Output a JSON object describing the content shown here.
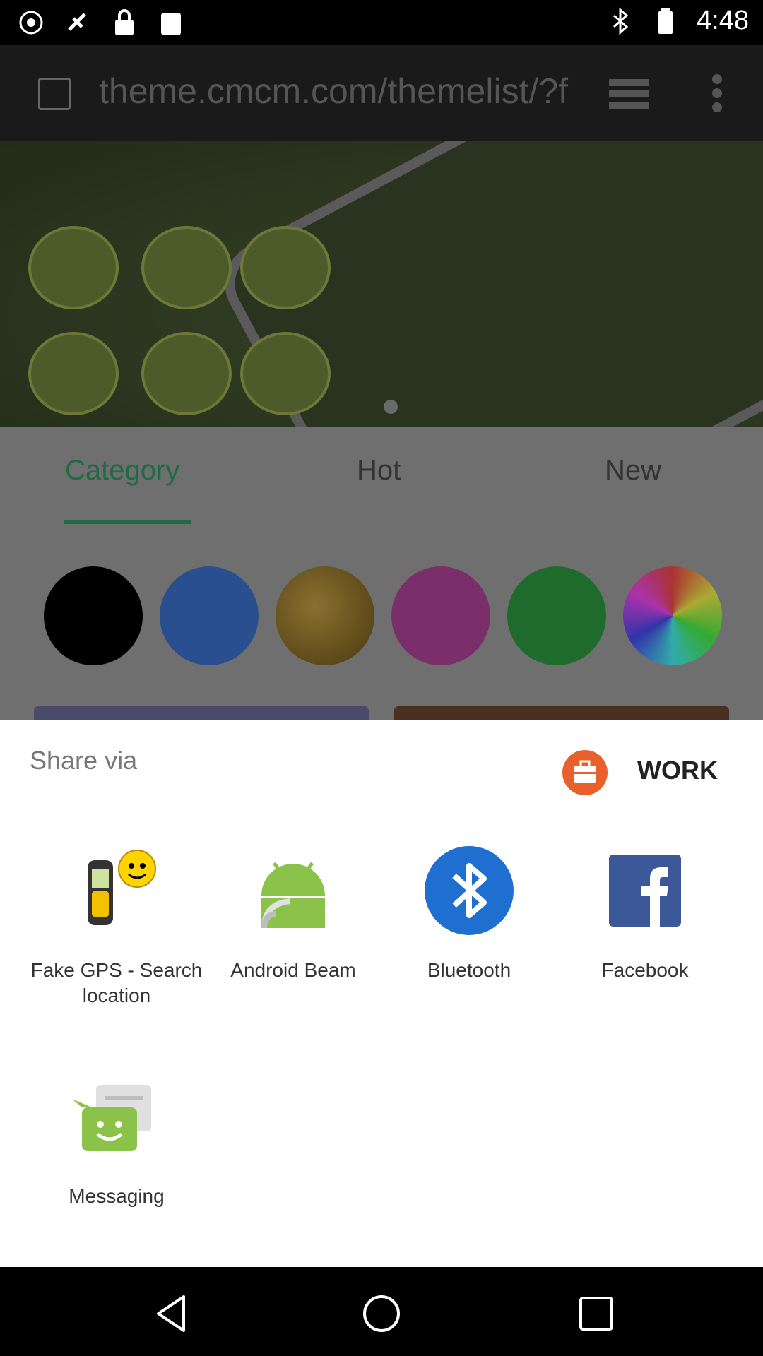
{
  "status_bar": {
    "time": "4:48",
    "left_icons": [
      "notification-icon",
      "location-icon",
      "lock-icon",
      "clipboard-icon"
    ],
    "right_icons": [
      "bluetooth-icon",
      "battery-icon"
    ]
  },
  "browser": {
    "url": "theme.cmcm.com/themelist/?f"
  },
  "tabs": [
    {
      "label": "Category",
      "active": true
    },
    {
      "label": "Hot"
    },
    {
      "label": "New"
    }
  ],
  "colors": {
    "accent": "#1f6b43",
    "swatches": [
      "#000000",
      "#2e5aa8",
      "#8a6a2a",
      "#8a3b7a",
      "#2e7d3c",
      "rainbow"
    ]
  },
  "share_sheet": {
    "title": "Share via",
    "work_label": "WORK",
    "apps": [
      {
        "label": "Fake GPS - Search location",
        "icon": "fake-gps-icon"
      },
      {
        "label": "Android Beam",
        "icon": "android-beam-icon"
      },
      {
        "label": "Bluetooth",
        "icon": "bluetooth-icon"
      },
      {
        "label": "Facebook",
        "icon": "facebook-icon"
      },
      {
        "label": "Messaging",
        "icon": "messaging-icon"
      }
    ]
  },
  "nav_bar": {
    "buttons": [
      "back-icon",
      "home-icon",
      "recents-icon"
    ]
  }
}
